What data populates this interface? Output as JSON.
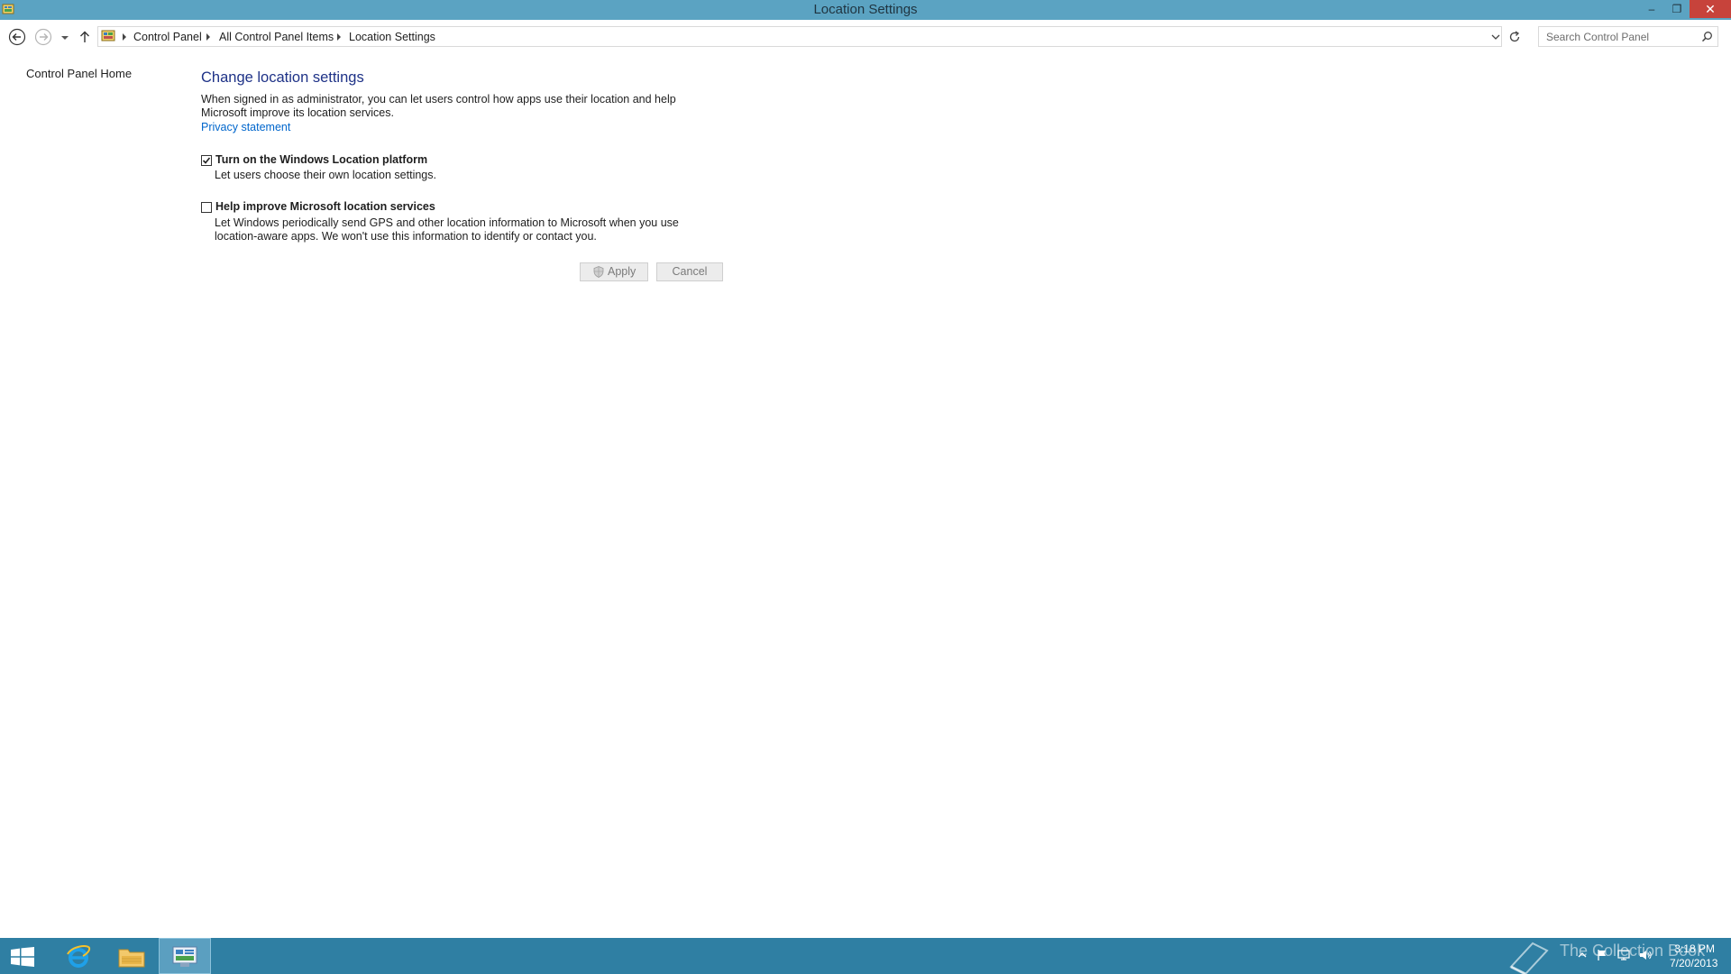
{
  "window": {
    "title": "Location Settings",
    "minimize_glyph": "–",
    "restore_glyph": "❐",
    "close_glyph": "✕"
  },
  "nav": {
    "breadcrumbs": [
      "Control Panel",
      "All Control Panel Items",
      "Location Settings"
    ],
    "search_placeholder": "Search Control Panel"
  },
  "left_pane": {
    "home_link": "Control Panel Home"
  },
  "main": {
    "heading": "Change location settings",
    "description": "When signed in as administrator, you can let users control how apps use their location and help Microsoft improve its location services.",
    "privacy_link": "Privacy statement",
    "options": [
      {
        "title": "Turn on the Windows Location platform",
        "description": "Let users choose their own location settings.",
        "checked": true
      },
      {
        "title": "Help improve Microsoft location services",
        "description_line1": "Let Windows periodically send GPS and other location information to Microsoft when you use",
        "description_line2": "location-aware apps. We won't use this information to identify or contact you.",
        "checked": false
      }
    ],
    "apply_label": "Apply",
    "cancel_label": "Cancel"
  },
  "taskbar": {
    "watermark": "The Collection Book",
    "time": "3:18 PM",
    "date": "7/20/2013"
  },
  "colors": {
    "titlebar": "#5ba3c2",
    "taskbar": "#2f7fa3",
    "heading": "#1e3287",
    "link": "#0066cc",
    "close_button": "#c7433b"
  }
}
